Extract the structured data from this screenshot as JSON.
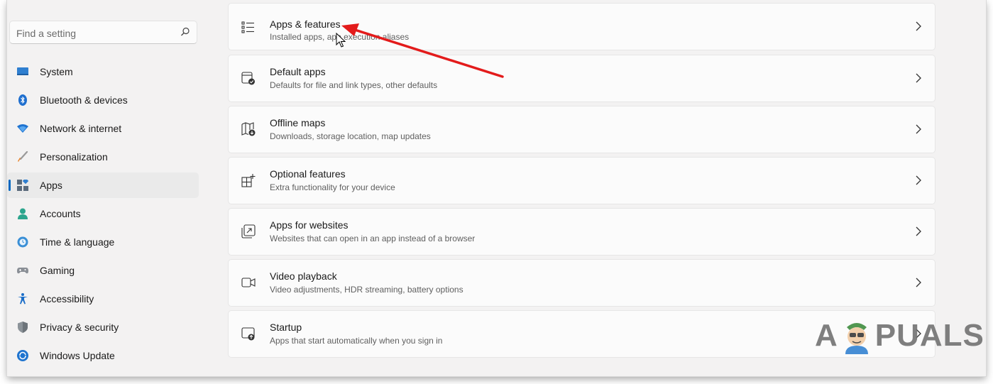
{
  "search": {
    "placeholder": "Find a setting"
  },
  "sidebar": {
    "items": [
      {
        "label": "System",
        "icon": "monitor-icon",
        "active": false
      },
      {
        "label": "Bluetooth & devices",
        "icon": "bluetooth-icon",
        "active": false
      },
      {
        "label": "Network & internet",
        "icon": "wifi-icon",
        "active": false
      },
      {
        "label": "Personalization",
        "icon": "brush-icon",
        "active": false
      },
      {
        "label": "Apps",
        "icon": "apps-icon",
        "active": true
      },
      {
        "label": "Accounts",
        "icon": "person-icon",
        "active": false
      },
      {
        "label": "Time & language",
        "icon": "clock-globe-icon",
        "active": false
      },
      {
        "label": "Gaming",
        "icon": "gamepad-icon",
        "active": false
      },
      {
        "label": "Accessibility",
        "icon": "accessibility-icon",
        "active": false
      },
      {
        "label": "Privacy & security",
        "icon": "shield-icon",
        "active": false
      },
      {
        "label": "Windows Update",
        "icon": "update-icon",
        "active": false
      }
    ]
  },
  "main": {
    "cards": [
      {
        "title": "Apps & features",
        "subtitle": "Installed apps, app execution aliases",
        "icon": "list-icon"
      },
      {
        "title": "Default apps",
        "subtitle": "Defaults for file and link types, other defaults",
        "icon": "default-apps-icon"
      },
      {
        "title": "Offline maps",
        "subtitle": "Downloads, storage location, map updates",
        "icon": "map-icon"
      },
      {
        "title": "Optional features",
        "subtitle": "Extra functionality for your device",
        "icon": "add-grid-icon"
      },
      {
        "title": "Apps for websites",
        "subtitle": "Websites that can open in an app instead of a browser",
        "icon": "open-in-app-icon"
      },
      {
        "title": "Video playback",
        "subtitle": "Video adjustments, HDR streaming, battery options",
        "icon": "video-camera-icon"
      },
      {
        "title": "Startup",
        "subtitle": "Apps that start automatically when you sign in",
        "icon": "startup-icon"
      }
    ]
  },
  "watermark": {
    "text_left": "A",
    "text_right": "PUALS"
  },
  "colors": {
    "accent": "#0067c0",
    "annotation_arrow": "#e31b1b"
  }
}
